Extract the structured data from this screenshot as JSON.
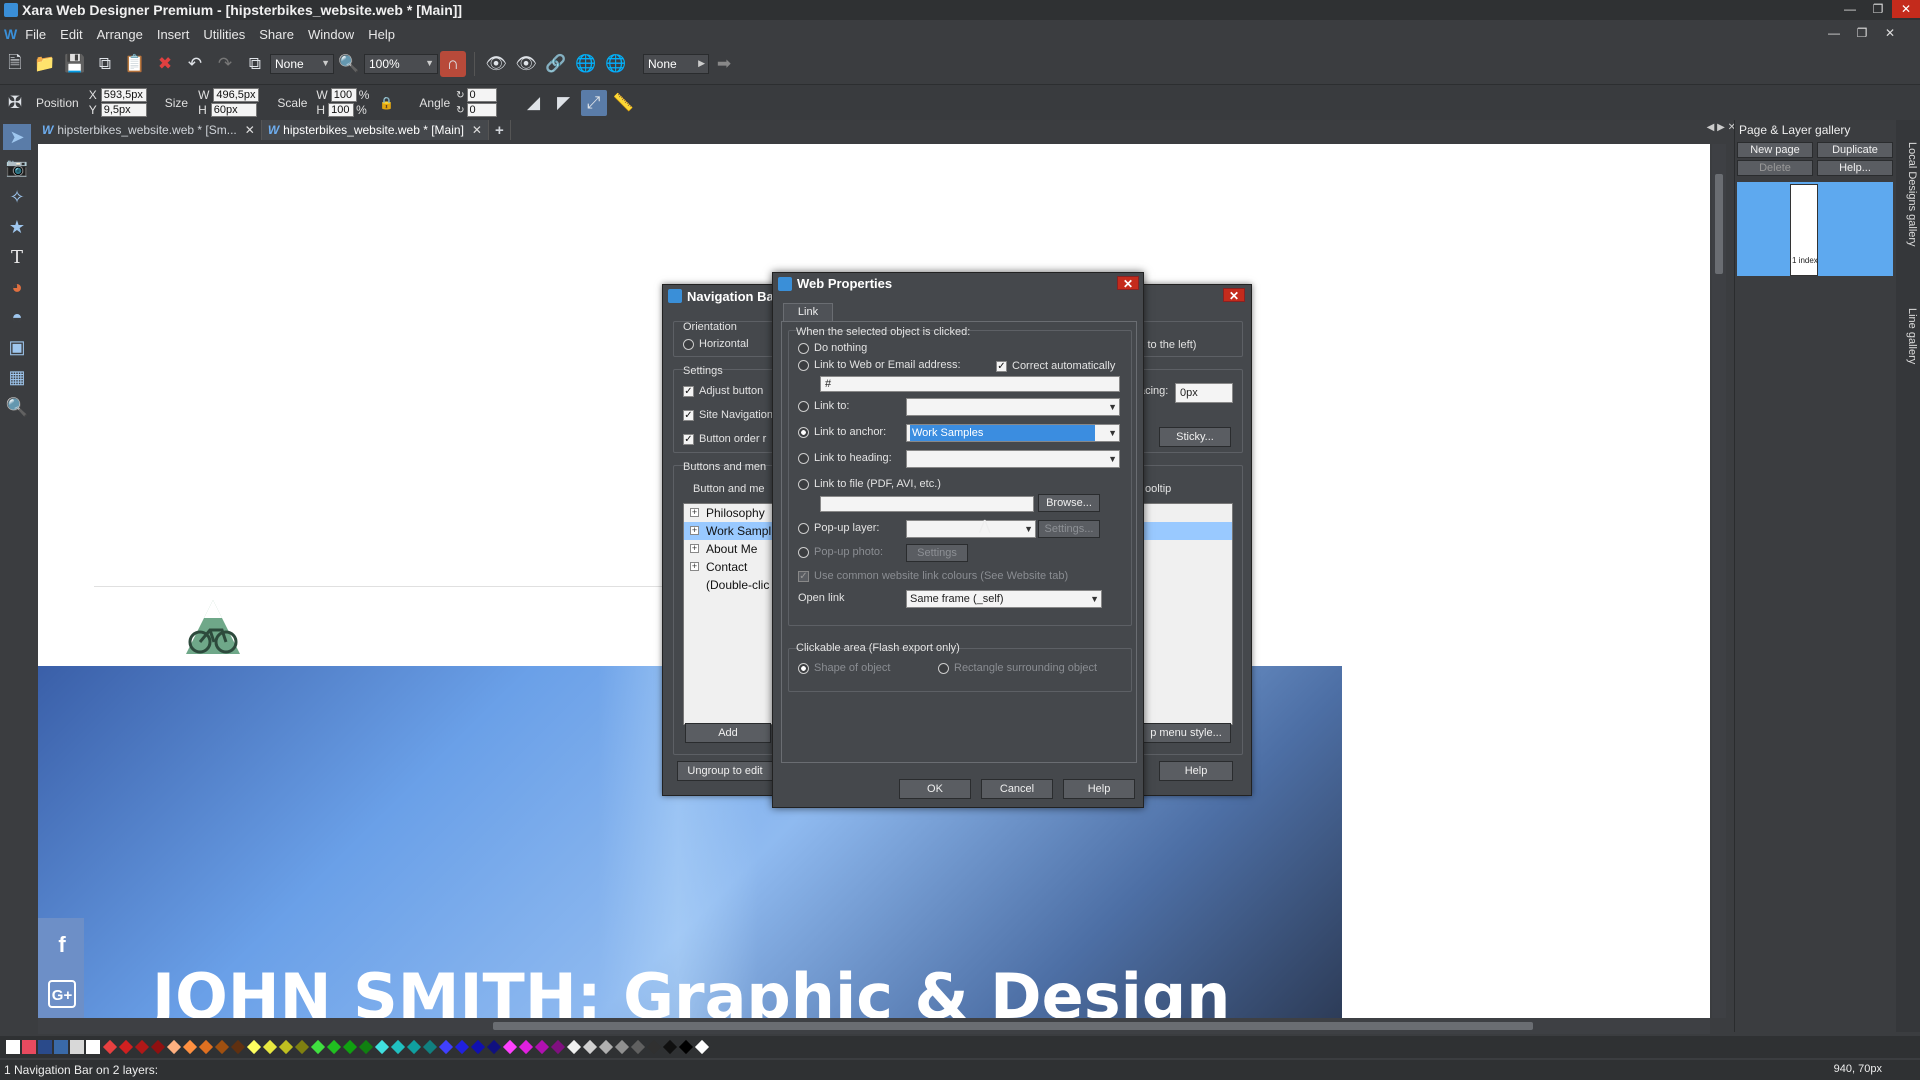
{
  "window": {
    "title": "Xara Web Designer Premium - [hipsterbikes_website.web * [Main]]"
  },
  "menu": {
    "items": [
      "File",
      "Edit",
      "Arrange",
      "Insert",
      "Utilities",
      "Share",
      "Window",
      "Help"
    ]
  },
  "toolbar1": {
    "fill_combo": "None",
    "zoom": "100%",
    "page_combo": "None"
  },
  "toolbar2": {
    "position_label": "Position",
    "x_label": "X",
    "x_value": "593,5px",
    "y_label": "Y",
    "y_value": "9,5px",
    "size_label": "Size",
    "w_label": "W",
    "w_value": "496,5px",
    "h_label": "H",
    "h_value": "60px",
    "scale_label": "Scale",
    "scale_w": "100",
    "scale_h": "100",
    "percent": "%",
    "angle_label": "Angle",
    "angle_value": "0",
    "angle_value2": "0"
  },
  "tabs": [
    {
      "label": "hipsterbikes_website.web * [Sm..."
    },
    {
      "label": "hipsterbikes_website.web * [Main]"
    }
  ],
  "canvas": {
    "hero_title": "JOHN SMITH: Graphic & Design",
    "facebook": "f",
    "googleplus": "G+"
  },
  "right_panel": {
    "title": "Page & Layer gallery",
    "new_page": "New page",
    "duplicate": "Duplicate",
    "delete": "Delete",
    "help": "Help...",
    "page_label": "1 index",
    "side_tab1": "Local Designs gallery",
    "side_tab2": "Line gallery"
  },
  "nav_dialog": {
    "title": "Navigation Ba",
    "orientation_label": "Orientation",
    "horizontal": "Horizontal",
    "arrows_left": "ws to the left)",
    "settings_label": "Settings",
    "adjust_button": "Adjust button",
    "site_navigation": "Site Navigation",
    "button_order": "Button order r",
    "spacing_label": "acing:",
    "spacing_value": "0px",
    "sticky": "Sticky...",
    "buttons_group": "Buttons and men",
    "col_button": "Button and me",
    "col_tooltip": "ooltip",
    "items": [
      "Philosophy",
      "Work Sampl",
      "About Me",
      "Contact",
      "(Double-clic"
    ],
    "add": "Add",
    "menu_style": "p menu style...",
    "ungroup": "Ungroup to edit",
    "help": "Help"
  },
  "web_dialog": {
    "title": "Web Properties",
    "tab": "Link",
    "when_clicked": "When the selected object is clicked:",
    "do_nothing": "Do nothing",
    "link_web": "Link to Web or Email address:",
    "correct_auto": "Correct automatically",
    "url_value": "#",
    "link_to": "Link to:",
    "link_anchor": "Link to anchor:",
    "anchor_value": "Work Samples",
    "link_heading": "Link to heading:",
    "link_file": "Link to file (PDF, AVI, etc.)",
    "browse": "Browse...",
    "popup_layer": "Pop-up layer:",
    "settings": "Settings...",
    "popup_photo": "Pop-up photo:",
    "settings2": "Settings",
    "use_common": "Use common website link colours (See Website tab)",
    "open_link": "Open link",
    "open_link_value": "Same frame (_self)",
    "clickable_area": "Clickable area (Flash export only)",
    "shape_of_object": "Shape of object",
    "rectangle": "Rectangle surrounding object",
    "ok": "OK",
    "cancel": "Cancel",
    "help": "Help"
  },
  "status": {
    "text": "1 Navigation Bar on 2 layers:",
    "coords": "940, 70px"
  },
  "colors": {
    "accent": "#3a8fd8",
    "selection": "#99c9ff",
    "close_red": "#c42b1c",
    "page_thumb": "#5ea9ef"
  }
}
